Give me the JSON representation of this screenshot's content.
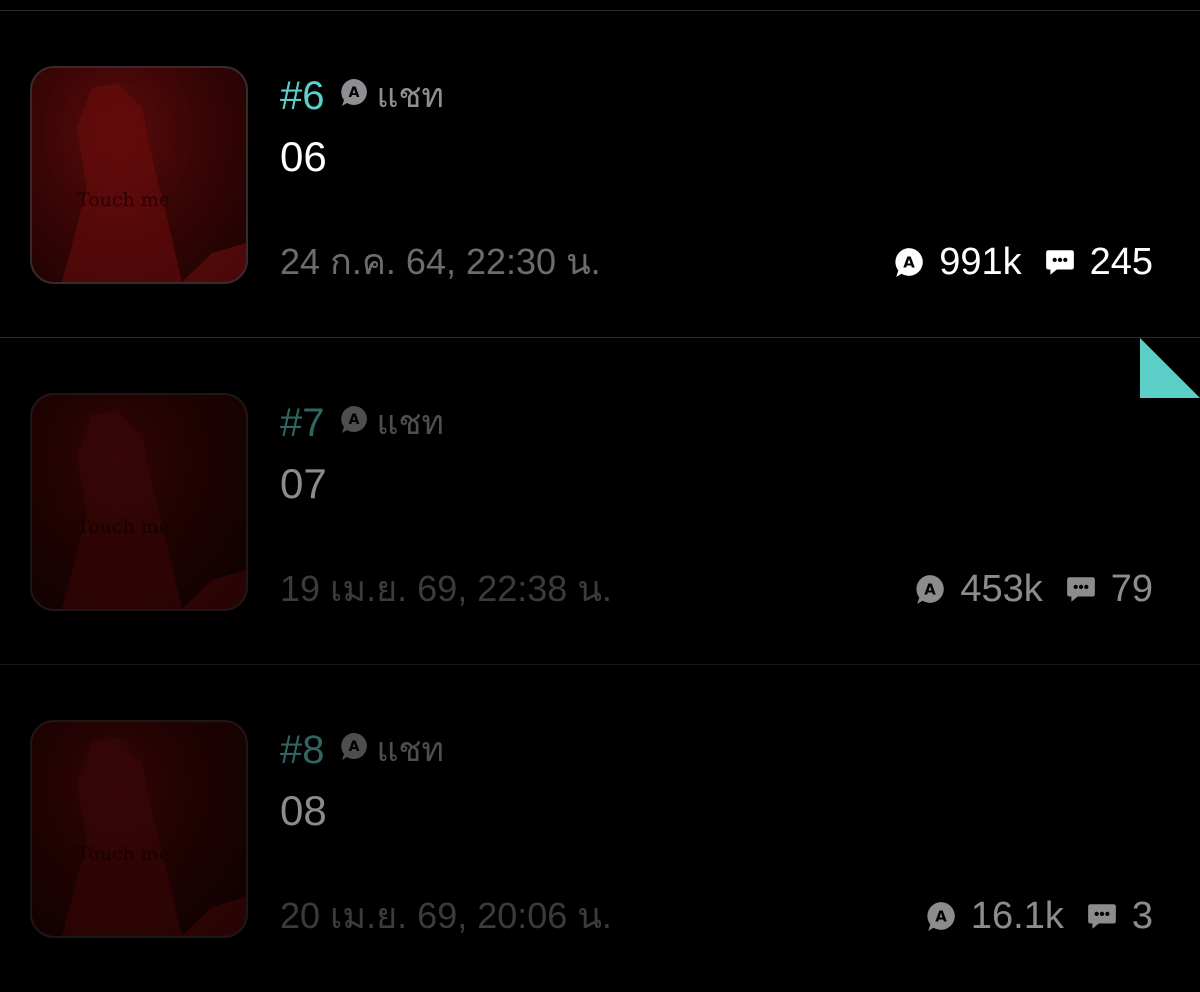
{
  "episodes": [
    {
      "number": "#6",
      "type": "แชท",
      "title": "06",
      "date": "24 ก.ค. 64, 22:30 น.",
      "views": "991k",
      "comments": "245",
      "thumb_text": "Touch me"
    },
    {
      "number": "#7",
      "type": "แชท",
      "title": "07",
      "date": "19 เม.ย. 69, 22:38 น.",
      "views": "453k",
      "comments": "79",
      "thumb_text": "Touch me"
    },
    {
      "number": "#8",
      "type": "แชท",
      "title": "08",
      "date": "20 เม.ย. 69, 20:06 น.",
      "views": "16.1k",
      "comments": "3",
      "thumb_text": "Touch me"
    }
  ],
  "colors": {
    "accent": "#5ccfc9",
    "background": "#000000",
    "muted": "#8e8e93"
  },
  "icons": {
    "badge": "chat-a-icon",
    "views": "view-a-icon",
    "comments": "comment-bubble-icon"
  }
}
